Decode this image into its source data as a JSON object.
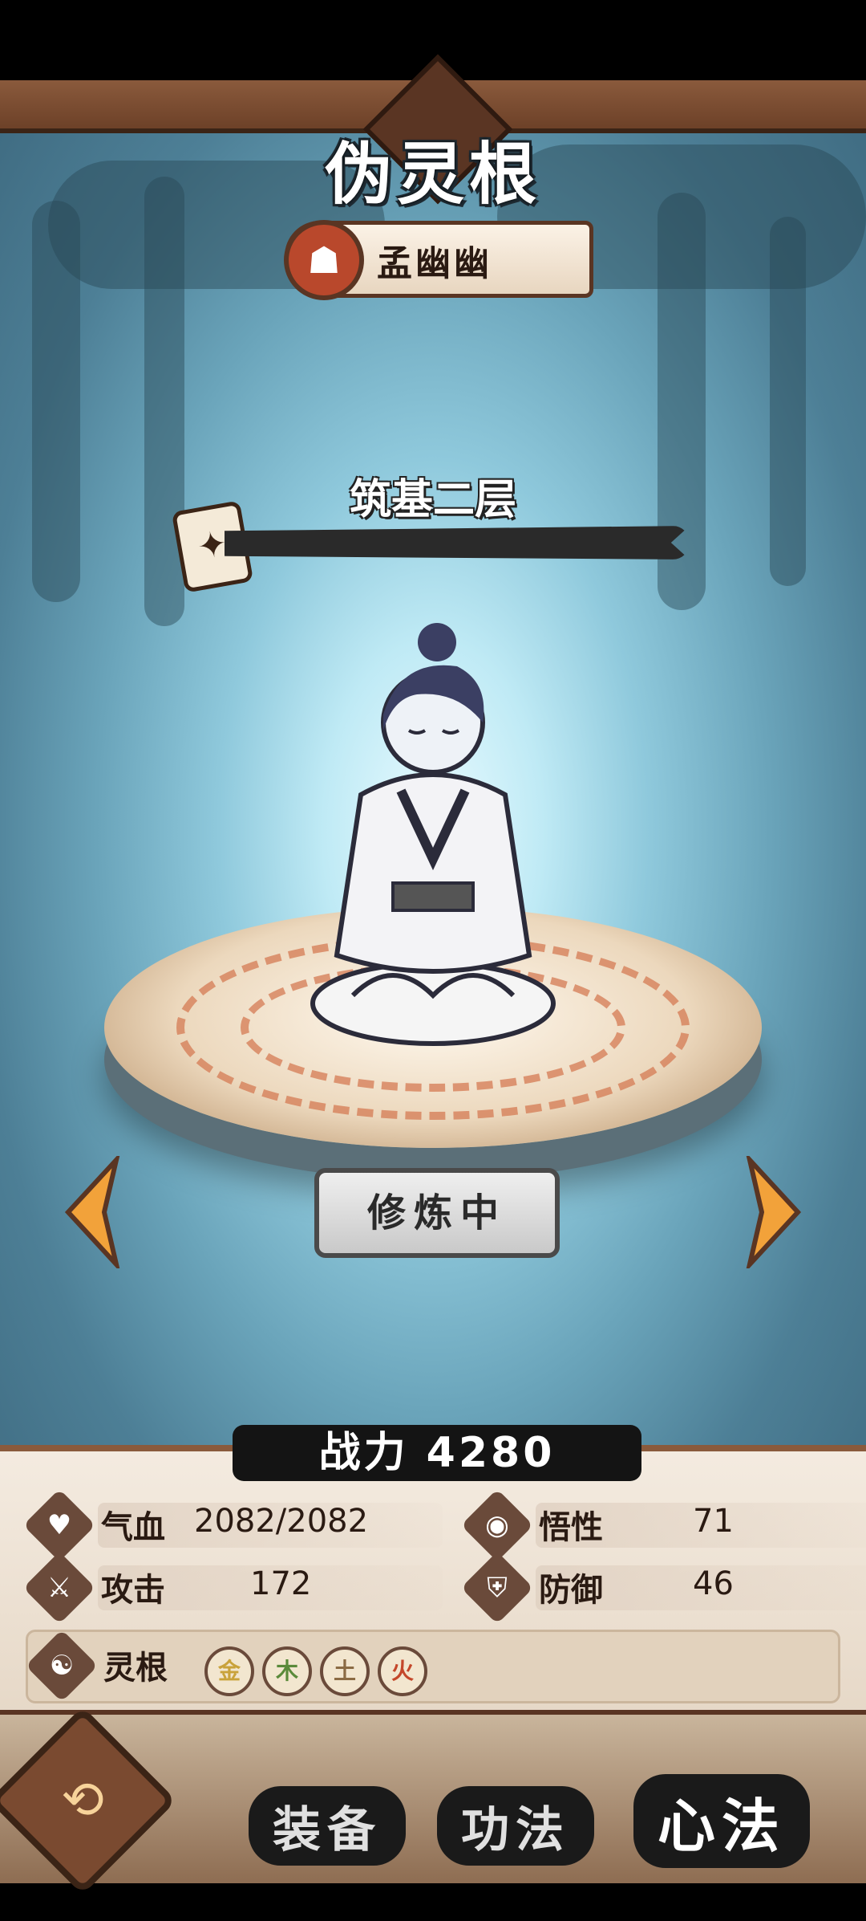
{
  "header": {
    "title": "伪灵根",
    "character_name": "孟幽幽"
  },
  "realm": {
    "label": "筑基二层",
    "progress": 0.0
  },
  "action": {
    "cultivate_label": "修炼中"
  },
  "power": {
    "label": "战力 4280"
  },
  "stats": {
    "hp": {
      "label": "气血",
      "value": "2082/2082",
      "icon": "heart-icon"
    },
    "comprehension": {
      "label": "悟性",
      "value": "71",
      "icon": "eye-icon"
    },
    "attack": {
      "label": "攻击",
      "value": "172",
      "icon": "sword-icon"
    },
    "defense": {
      "label": "防御",
      "value": "46",
      "icon": "shield-icon"
    }
  },
  "spirit_root": {
    "label": "灵根",
    "elements": [
      {
        "char": "金",
        "color": "#c9a23a"
      },
      {
        "char": "木",
        "color": "#5a8a3a"
      },
      {
        "char": "土",
        "color": "#8b6b43"
      },
      {
        "char": "火",
        "color": "#c4472a"
      }
    ]
  },
  "nav": {
    "tabs": [
      "装备",
      "功法",
      "心法"
    ],
    "active": "心法"
  }
}
